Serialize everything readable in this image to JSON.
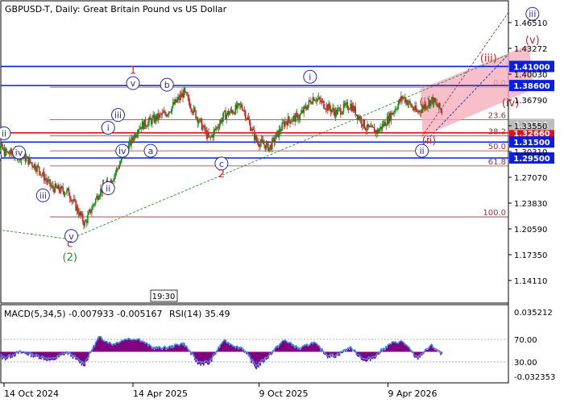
{
  "header": {
    "symbol_line": "GBPUSD-T, Daily:  Great Britain Pound vs US Dollar",
    "time_badge": "19:30"
  },
  "indicator_header": {
    "macd_text": "MACD(5,34,5) -0.007933 -0.005167",
    "rsi_text": "RSI(14) 35.49"
  },
  "colors": {
    "up_candle": "#1a8c1a",
    "down_candle": "#c8262a",
    "wave_blue": "#2a2a9e",
    "wave_red": "#c8262a",
    "trend_green": "#2e8b2e",
    "fib_brown": "#8b3a3a",
    "level_blue": "#0a1ee0",
    "level_red": "#e0101a",
    "channel_fill": "#f4a9b8",
    "macd_hist": "#800080",
    "rsi_line": "#3c8cf0"
  },
  "chart_data": [
    {
      "type": "line",
      "title": "GBPUSD-T, Daily:  Great Britain Pound vs US Dollar",
      "x_tick_labels": [
        "14 Oct 2024",
        "14 Apr 2025",
        "9 Oct 2025",
        "9 Apr 2026"
      ],
      "y_tick_labels": [
        "1.46510",
        "1.43272",
        "1.40030",
        "1.36790",
        "1.33550",
        "1.30310",
        "1.27070",
        "1.23830",
        "1.20590",
        "1.17350",
        "1.14110"
      ],
      "ylim": [
        1.126,
        1.482
      ],
      "grid": false,
      "price_path_x": [
        "2024-09-25",
        "2024-10-15",
        "2024-11-10",
        "2024-12-01",
        "2024-12-20",
        "2025-01-13",
        "2025-02-05",
        "2025-02-25",
        "2025-03-15",
        "2025-04-03",
        "2025-04-22",
        "2025-05-12",
        "2025-06-01",
        "2025-06-25",
        "2025-07-10",
        "2025-07-31",
        "2025-08-20",
        "2025-09-15",
        "2025-10-05",
        "2025-10-24",
        "2025-11-15",
        "2025-12-05",
        "2025-12-25",
        "2026-01-25",
        "2026-02-15",
        "2026-03-10",
        "2026-03-25",
        "2026-04-10",
        "2026-04-30",
        "2026-05-20",
        "2026-06-10",
        "2026-06-25"
      ],
      "price_path_y": [
        1.322,
        1.302,
        1.297,
        1.282,
        1.258,
        1.252,
        1.212,
        1.252,
        1.268,
        1.301,
        1.334,
        1.343,
        1.352,
        1.377,
        1.352,
        1.318,
        1.348,
        1.361,
        1.317,
        1.308,
        1.341,
        1.347,
        1.372,
        1.352,
        1.362,
        1.332,
        1.328,
        1.345,
        1.372,
        1.352,
        1.368,
        1.353
      ],
      "horizontal_levels": [
        {
          "label": "1.41000",
          "value": 1.41,
          "color": "#0a1ee0"
        },
        {
          "label": "1.38600",
          "value": 1.386,
          "color": "#0a1ee0"
        },
        {
          "label": "1.32660",
          "value": 1.3266,
          "color": "#e0101a"
        },
        {
          "label": "1.31500",
          "value": 1.315,
          "color": "#0a1ee0"
        },
        {
          "label": "1.29500",
          "value": 1.295,
          "color": "#0a1ee0"
        }
      ],
      "current_price_label": "1.33715",
      "fibonacci": [
        {
          "label": "0.0",
          "value": 1.384
        },
        {
          "label": "23.6",
          "value": 1.343
        },
        {
          "label": "38.2",
          "value": 1.323
        },
        {
          "label": "50.0",
          "value": 1.304
        },
        {
          "label": "61.8",
          "value": 1.285
        },
        {
          "label": "100.0",
          "value": 1.221
        }
      ],
      "wave_labels": [
        {
          "text": "ii",
          "date": "2024-10-14",
          "y": 1.326,
          "color": "blue",
          "circle": true
        },
        {
          "text": "i",
          "date": "2024-10-01",
          "y": 1.297,
          "color": "blue",
          "circle": true
        },
        {
          "text": "iv",
          "date": "2024-11-04",
          "y": 1.302,
          "color": "blue",
          "circle": true
        },
        {
          "text": "iii",
          "date": "2024-12-08",
          "y": 1.248,
          "color": "blue",
          "circle": true
        },
        {
          "text": "v",
          "date": "2025-01-17",
          "y": 1.197,
          "color": "blue",
          "circle": true
        },
        {
          "text": "c",
          "date": "2025-01-15",
          "y": 1.187,
          "color": "red",
          "circle": false
        },
        {
          "text": "(2)",
          "date": "2025-01-15",
          "y": 1.17,
          "color": "green",
          "circle": false
        },
        {
          "text": "iii",
          "date": "2025-03-24",
          "y": 1.349,
          "color": "blue",
          "circle": true
        },
        {
          "text": "i",
          "date": "2025-03-10",
          "y": 1.333,
          "color": "blue",
          "circle": true
        },
        {
          "text": "iv",
          "date": "2025-03-30",
          "y": 1.304,
          "color": "blue",
          "circle": true
        },
        {
          "text": "ii",
          "date": "2025-03-10",
          "y": 1.257,
          "color": "blue",
          "circle": true
        },
        {
          "text": "1",
          "date": "2025-04-14",
          "y": 1.405,
          "color": "red",
          "circle": false
        },
        {
          "text": "v",
          "date": "2025-04-14",
          "y": 1.389,
          "color": "blue",
          "circle": true
        },
        {
          "text": "b",
          "date": "2025-06-01",
          "y": 1.387,
          "color": "blue",
          "circle": true
        },
        {
          "text": "a",
          "date": "2025-05-09",
          "y": 1.304,
          "color": "blue",
          "circle": true
        },
        {
          "text": "c",
          "date": "2025-08-17",
          "y": 1.288,
          "color": "blue",
          "circle": true
        },
        {
          "text": "2",
          "date": "2025-08-17",
          "y": 1.275,
          "color": "red",
          "circle": false
        },
        {
          "text": "i",
          "date": "2025-12-20",
          "y": 1.397,
          "color": "blue",
          "circle": true
        },
        {
          "text": "ii",
          "date": "2026-05-27",
          "y": 1.304,
          "color": "blue",
          "circle": true
        },
        {
          "text": "(i)",
          "date": "2026-05-31",
          "y": 1.365,
          "color": "red",
          "circle": false
        },
        {
          "text": "(ii)",
          "date": "2026-06-06",
          "y": 1.317,
          "color": "red",
          "circle": false
        },
        {
          "text": "(iii)",
          "date": "2026-08-29",
          "y": 1.42,
          "color": "red",
          "circle": false
        },
        {
          "text": "(iv)",
          "date": "2026-09-29",
          "y": 1.364,
          "color": "red",
          "circle": false
        },
        {
          "text": "(v)",
          "date": "2026-10-30",
          "y": 1.443,
          "color": "red",
          "circle": false
        },
        {
          "text": "iii",
          "date": "2026-10-30",
          "y": 1.476,
          "color": "blue",
          "circle": true
        }
      ]
    },
    {
      "type": "bar",
      "title": "MACD(5,34,5) -0.007933 -0.005167",
      "right_axis_labels": [
        "0.035212",
        "-0.032353"
      ],
      "ylim": [
        -0.032353,
        0.035212
      ],
      "legend": "top-left"
    },
    {
      "type": "line",
      "title": "RSI(14) 35.49",
      "levels": [
        70.0,
        30.0
      ],
      "level_labels": [
        "70.00",
        "30.00"
      ],
      "last_value": 35.49
    }
  ]
}
